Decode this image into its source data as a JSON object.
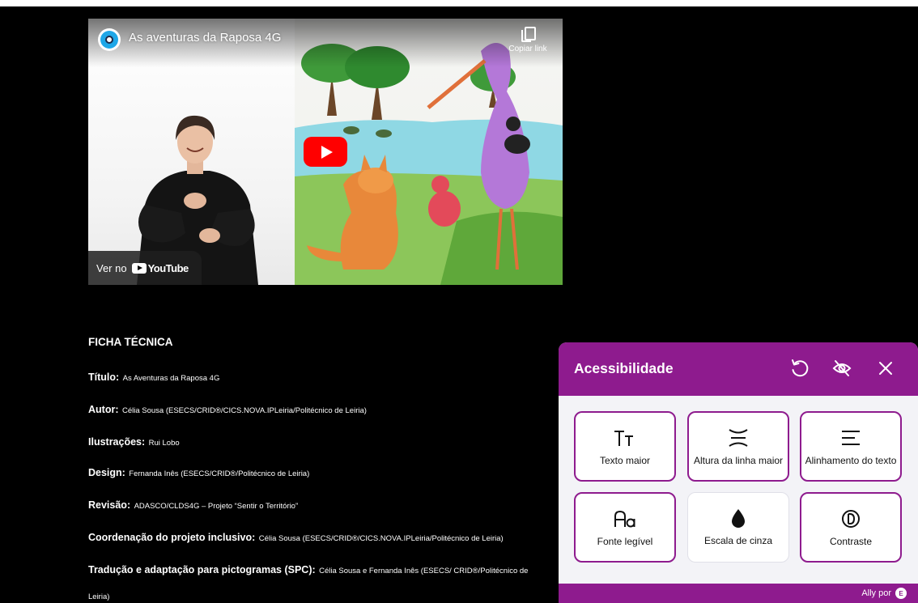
{
  "video": {
    "title": "As aventuras da Raposa 4G",
    "copy_link_label": "Copiar link",
    "watch_on_label": "Ver no",
    "youtube_label": "YouTube"
  },
  "ficha": {
    "heading": "FICHA TÉCNICA",
    "rows": [
      {
        "label": "Título:",
        "value": "As Aventuras da Raposa 4G"
      },
      {
        "label": "Autor:",
        "value": "Célia Sousa (ESECS/CRID®/CICS.NOVA.IPLeiria/Politécnico de Leiria)"
      },
      {
        "label": "Ilustrações:",
        "value": "Rui Lobo"
      },
      {
        "label": "Design:",
        "value": "Fernanda Inês (ESECS/CRID®/Politécnico de Leiria)"
      },
      {
        "label": "Revisão:",
        "value": "ADASCO/CLDS4G – Projeto “Sentir o Território”"
      },
      {
        "label": "Coordenação do projeto inclusivo:",
        "value": "Célia Sousa (ESECS/CRID®/CICS.NOVA.IPLeiria/Politécnico de Leiria)"
      },
      {
        "label": "Tradução e adaptação para pictogramas (SPC):",
        "value": "Célia Sousa e Fernanda Inês (ESECS/ CRID®/Politécnico de"
      }
    ],
    "continuation": "Leiria)"
  },
  "ally": {
    "title": "Acessibilidade",
    "tiles": [
      {
        "label": "Texto maior",
        "icon": "text-size-icon"
      },
      {
        "label": "Altura da linha maior",
        "icon": "line-height-icon"
      },
      {
        "label": "Alinhamento do texto",
        "icon": "text-align-icon"
      },
      {
        "label": "Fonte legível",
        "icon": "readable-font-icon"
      },
      {
        "label": "Escala de cinza",
        "icon": "grayscale-drop-icon"
      },
      {
        "label": "Contraste",
        "icon": "contrast-icon"
      }
    ],
    "footer_label": "Ally por",
    "footer_badge": "E",
    "accent_color": "#8e1b8e"
  }
}
